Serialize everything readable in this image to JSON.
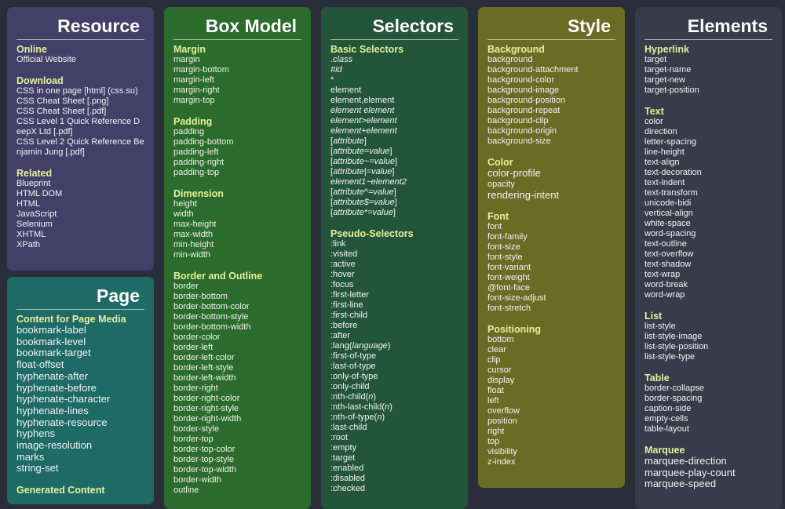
{
  "panels": {
    "resource": {
      "title": "Resource",
      "color": "#424068",
      "sections": [
        {
          "heading": "Online",
          "items": [
            "Official Website"
          ]
        },
        {
          "heading": "Download",
          "items": [
            "CSS in one page [html] (css.su)",
            "CSS Cheat Sheet [.png]",
            "CSS Cheat Sheet [.pdf]",
            "CSS Level 1 Quick Reference DeepX Ltd [.pdf]",
            "CSS Level 2 Quick Reference Benjamin Jung [.pdf]"
          ]
        },
        {
          "heading": "Related",
          "items": [
            "Blueprint",
            "HTML DOM",
            "HTML",
            "JavaScript",
            "Selenium",
            "XHTML",
            "XPath"
          ]
        }
      ]
    },
    "page": {
      "title": "Page",
      "color": "#1e6a66",
      "sections": [
        {
          "heading": "Content for Page Media",
          "items": [
            "bookmark-label",
            "bookmark-level",
            "bookmark-target",
            "float-offset",
            "hyphenate-after",
            "hyphenate-before",
            "hyphenate-character",
            "hyphenate-lines",
            "hyphenate-resource",
            "hyphens",
            "image-resolution",
            "marks",
            "string-set"
          ]
        },
        {
          "heading": "Generated Content",
          "items": []
        }
      ]
    },
    "box_model": {
      "title": "Box Model",
      "color": "#2b6b2b",
      "sections": [
        {
          "heading": "Margin",
          "items": [
            "margin",
            "margin-bottom",
            "margin-left",
            "margin-right",
            "margin-top"
          ]
        },
        {
          "heading": "Padding",
          "items": [
            "padding",
            "padding-bottom",
            "padding-left",
            "padding-right",
            "padding-top"
          ]
        },
        {
          "heading": "Dimension",
          "items": [
            "height",
            "width",
            "max-height",
            "max-width",
            "min-height",
            "min-width"
          ]
        },
        {
          "heading": "Border and Outline",
          "items": [
            "border",
            "border-bottom",
            "border-bottom-color",
            "border-bottom-style",
            "border-bottom-width",
            "border-color",
            "border-left",
            "border-left-color",
            "border-left-style",
            "border-left-width",
            "border-right",
            "border-right-color",
            "border-right-style",
            "border-right-width",
            "border-style",
            "border-top",
            "border-top-color",
            "border-top-style",
            "border-top-width",
            "border-width",
            "outline"
          ]
        }
      ]
    },
    "selectors": {
      "title": "Selectors",
      "color": "#23553a",
      "sections": [
        {
          "heading": "Basic Selectors",
          "items": [
            ".class",
            "#id",
            "*",
            "element",
            "element,element",
            "element element",
            "element>element",
            "element+element",
            "[attribute]",
            "[attribute=value]",
            "[attribute~=value]",
            "[attribute|=value]",
            "element1~element2",
            "[attribute^=value]",
            "[attribute$=value]",
            "[attribute*=value]"
          ]
        },
        {
          "heading": "Pseudo-Selectors",
          "items": [
            ":link",
            ":visited",
            ":active",
            ":hover",
            ":focus",
            ":first-letter",
            ":first-line",
            ":first-child",
            ":before",
            ":after",
            ":lang(language)",
            ":first-of-type",
            ":last-of-type",
            ":only-of-type",
            ":only-child",
            ":nth-child(n)",
            ":nth-last-child(n)",
            ":nth-of-type(n)",
            ":last-child",
            ":root",
            ":empty",
            ":target",
            ":enabled",
            ":disabled",
            ":checked"
          ]
        }
      ]
    },
    "style": {
      "title": "Style",
      "color": "#6b6b26",
      "sections": [
        {
          "heading": "Background",
          "items": [
            "background",
            "background-attachment",
            "background-color",
            "background-image",
            "background-position",
            "background-repeat",
            "background-clip",
            "background-origin",
            "background-size"
          ]
        },
        {
          "heading": "Color",
          "items": [
            "color-profile",
            "opacity",
            "rendering-intent"
          ]
        },
        {
          "heading": "Font",
          "items": [
            "font",
            "font-family",
            "font-size",
            "font-style",
            "font-variant",
            "font-weight",
            "@font-face",
            "font-size-adjust",
            "font-stretch"
          ]
        },
        {
          "heading": "Positioning",
          "items": [
            "bottom",
            "clear",
            "clip",
            "cursor",
            "display",
            "float",
            "left",
            "overflow",
            "position",
            "right",
            "top",
            "visibility",
            "z-index"
          ]
        }
      ]
    },
    "elements": {
      "title": "Elements",
      "color": "#363c49",
      "sections": [
        {
          "heading": "Hyperlink",
          "items": [
            "target",
            "target-name",
            "target-new",
            "target-position"
          ]
        },
        {
          "heading": "Text",
          "items": [
            "color",
            "direction",
            "letter-spacing",
            "line-height",
            "text-align",
            "text-decoration",
            "text-indent",
            "text-transform",
            "unicode-bidi",
            "vertical-align",
            "white-space",
            "word-spacing",
            "text-outline",
            "text-overflow",
            "text-shadow",
            "text-wrap",
            "word-break",
            "word-wrap"
          ]
        },
        {
          "heading": "List",
          "items": [
            "list-style",
            "list-style-image",
            "list-style-position",
            "list-style-type"
          ]
        },
        {
          "heading": "Table",
          "items": [
            "border-collapse",
            "border-spacing",
            "caption-side",
            "empty-cells",
            "table-layout"
          ]
        },
        {
          "heading": "Marquee",
          "items": [
            "marquee-direction",
            "marquee-play-count",
            "marquee-speed"
          ]
        }
      ]
    }
  },
  "theme": {
    "background": "#2a2d3a",
    "heading_color": "#e6f09a",
    "text_color": "#f2f2f2"
  }
}
